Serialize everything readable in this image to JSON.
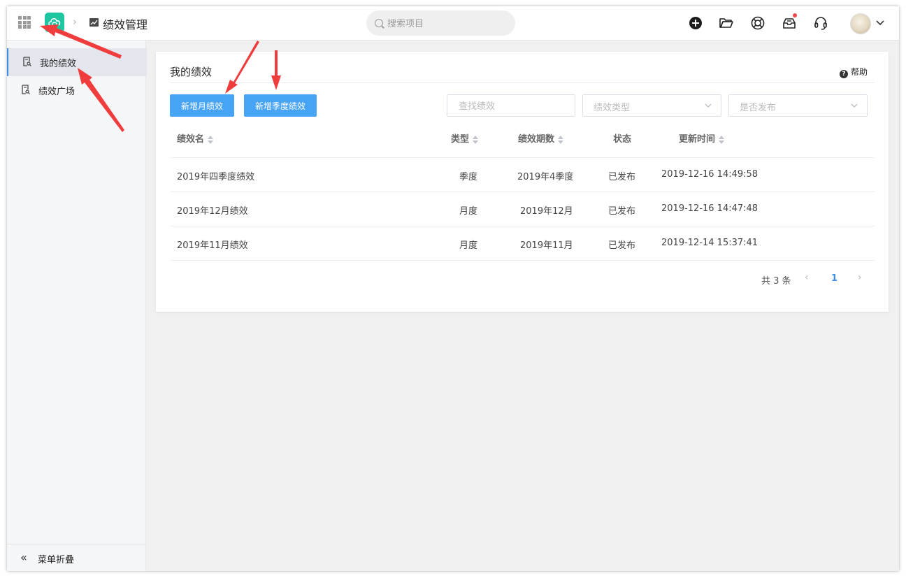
{
  "header": {
    "breadcrumb_title": "绩效管理",
    "search_placeholder": "搜索项目"
  },
  "sidebar": {
    "items": [
      {
        "label": "我的绩效",
        "active": true
      },
      {
        "label": "绩效广场",
        "active": false
      }
    ],
    "collapse_label": "菜单折叠"
  },
  "main": {
    "title": "我的绩效",
    "help_label": "帮助",
    "buttons": {
      "add_month": "新增月绩效",
      "add_quarter": "新增季度绩效"
    },
    "filters": {
      "search_placeholder": "查找绩效",
      "type_placeholder": "绩效类型",
      "published_placeholder": "是否发布"
    },
    "table": {
      "columns": [
        "绩效名",
        "类型",
        "绩效期数",
        "状态",
        "更新时间"
      ],
      "rows": [
        [
          "2019年四季度绩效",
          "季度",
          "2019年4季度",
          "已发布",
          "2019-12-16 14:49:58"
        ],
        [
          "2019年12月绩效",
          "月度",
          "2019年12月",
          "已发布",
          "2019-12-16 14:47:48"
        ],
        [
          "2019年11月绩效",
          "月度",
          "2019年11月",
          "已发布",
          "2019-12-14 15:37:41"
        ]
      ]
    },
    "pagination": {
      "total_text": "共 3 条",
      "current_page": "1"
    }
  },
  "colors": {
    "primary_button": "#47a3f5",
    "accent": "#3a8ee6",
    "logo": "#1fc6a1",
    "annotation_arrow": "#f03c3c"
  },
  "icons": [
    "apps-grid-icon",
    "app-logo-cloud-icon",
    "chart-icon",
    "search-icon",
    "add-circle-icon",
    "folder-open-icon",
    "lifebuoy-icon",
    "inbox-icon",
    "headset-icon",
    "avatar",
    "chevron-down-icon",
    "document-search-icon",
    "double-chevron-left-icon",
    "help-icon",
    "sort-icon"
  ]
}
